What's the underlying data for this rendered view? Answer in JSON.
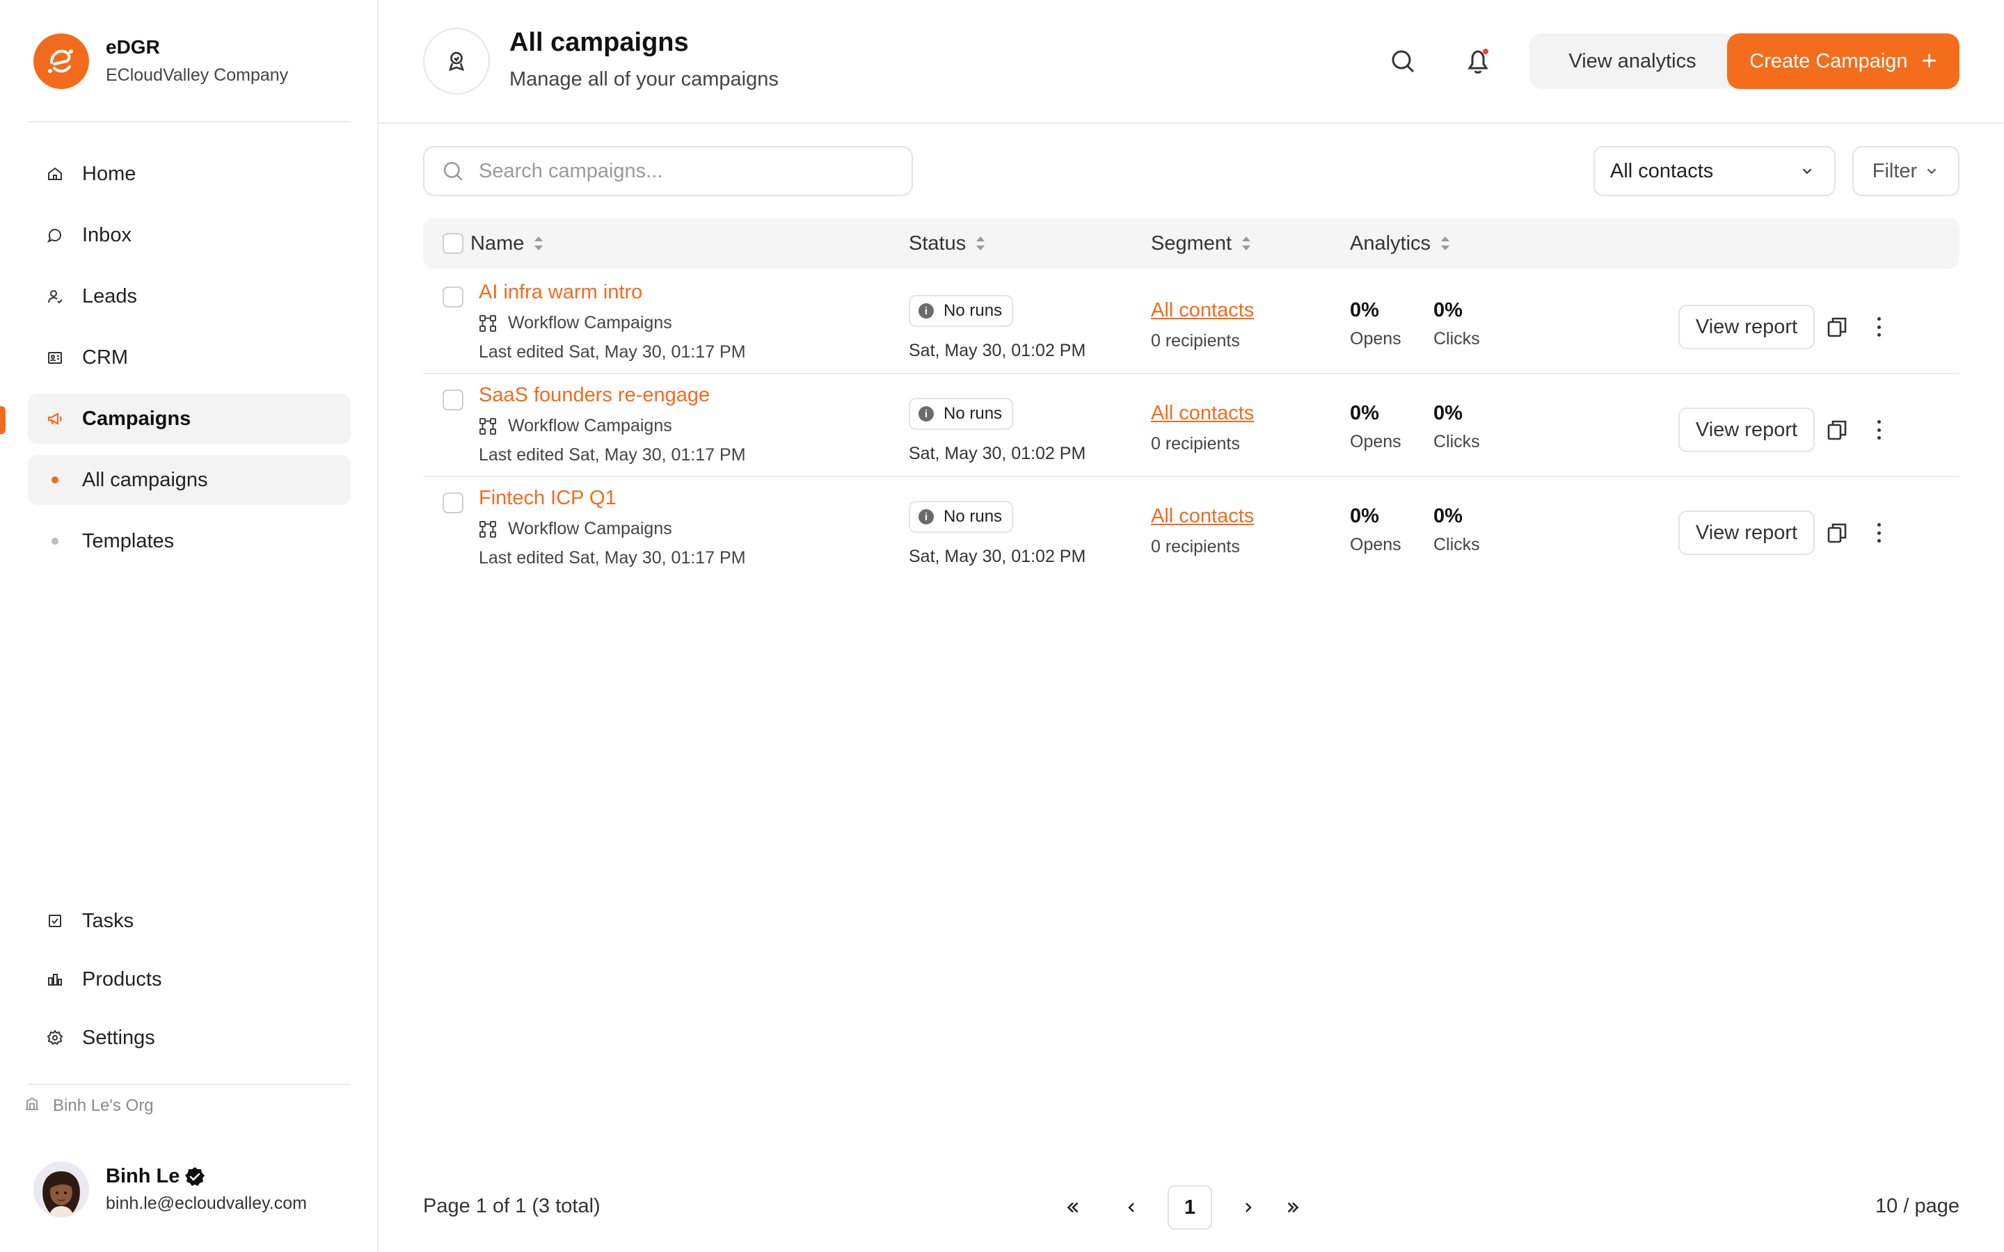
{
  "brand": {
    "name": "eDGR",
    "company": "ECloudValley Company"
  },
  "nav": {
    "home": "Home",
    "inbox": "Inbox",
    "leads": "Leads",
    "crm": "CRM",
    "campaigns": "Campaigns",
    "all_campaigns": "All campaigns",
    "templates": "Templates",
    "tasks": "Tasks",
    "products": "Products",
    "settings": "Settings"
  },
  "org": "Binh Le's Org",
  "user": {
    "name": "Binh Le",
    "email": "binh.le@ecloudvalley.com"
  },
  "header": {
    "title": "All campaigns",
    "subtitle": "Manage all of your campaigns",
    "analytics_label": "View analytics",
    "create_label": "Create Campaign",
    "create_icon": "+"
  },
  "toolbar": {
    "search_placeholder": "Search campaigns...",
    "contacts_select": "All contacts",
    "filter_label": "Filter"
  },
  "table": {
    "columns": {
      "name": "Name",
      "status": "Status",
      "segment": "Segment",
      "analytics": "Analytics"
    },
    "rows": [
      {
        "name": "AI infra warm intro",
        "type": "Workflow Campaigns",
        "edited": "Last edited Sat, May 30, 01:17 PM",
        "status": "No runs",
        "status_date": "Sat, May 30, 01:02 PM",
        "segment": "All contacts",
        "recipients": "0 recipients",
        "opens_val": "0%",
        "opens_lbl": "Opens",
        "clicks_val": "0%",
        "clicks_lbl": "Clicks",
        "report_label": "View report"
      },
      {
        "name": "SaaS founders re-engage",
        "type": "Workflow Campaigns",
        "edited": "Last edited Sat, May 30, 01:17 PM",
        "status": "No runs",
        "status_date": "Sat, May 30, 01:02 PM",
        "segment": "All contacts",
        "recipients": "0 recipients",
        "opens_val": "0%",
        "opens_lbl": "Opens",
        "clicks_val": "0%",
        "clicks_lbl": "Clicks",
        "report_label": "View report"
      },
      {
        "name": "Fintech ICP Q1",
        "type": "Workflow Campaigns",
        "edited": "Last edited Sat, May 30, 01:17 PM",
        "status": "No runs",
        "status_date": "Sat, May 30, 01:02 PM",
        "segment": "All contacts",
        "recipients": "0 recipients",
        "opens_val": "0%",
        "opens_lbl": "Opens",
        "clicks_val": "0%",
        "clicks_lbl": "Clicks",
        "report_label": "View report"
      }
    ]
  },
  "footer": {
    "page_info": "Page 1 of 1 (3 total)",
    "current_page": "1",
    "per_page": "10 / page"
  },
  "colors": {
    "accent": "#f26b1d",
    "border": "#e3e3e3",
    "muted": "#f3f3f3"
  },
  "icons": [
    "brand-logo-icon",
    "home-icon",
    "inbox-icon",
    "leads-icon",
    "crm-icon",
    "campaigns-icon",
    "tasks-icon",
    "products-icon",
    "settings-icon",
    "org-icon",
    "verified-icon",
    "campaign-header-icon",
    "search-icon",
    "bell-icon",
    "plus-icon",
    "chevron-down-icon",
    "sort-icon",
    "workflow-icon",
    "info-icon",
    "copy-icon",
    "more-icon",
    "first-page-icon",
    "prev-page-icon",
    "next-page-icon",
    "last-page-icon"
  ]
}
